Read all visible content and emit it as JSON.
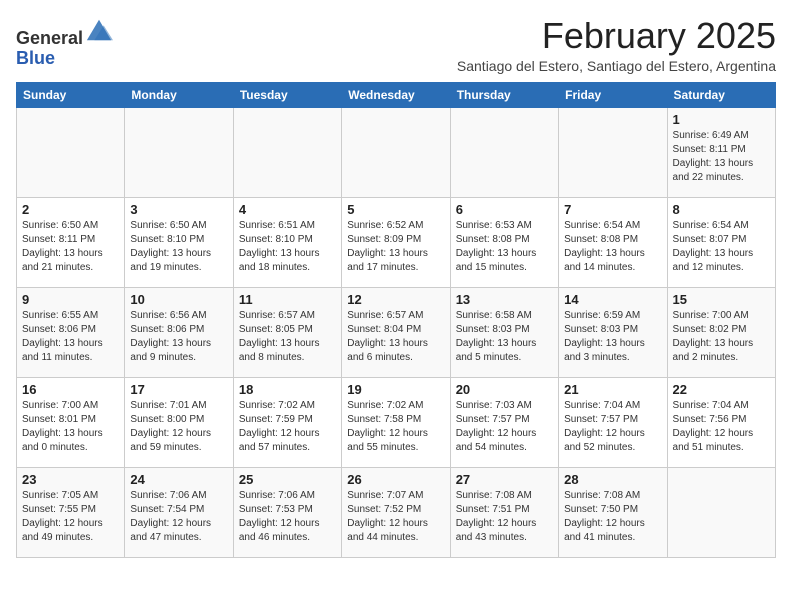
{
  "logo": {
    "general": "General",
    "blue": "Blue"
  },
  "header": {
    "month_year": "February 2025",
    "location": "Santiago del Estero, Santiago del Estero, Argentina"
  },
  "weekdays": [
    "Sunday",
    "Monday",
    "Tuesday",
    "Wednesday",
    "Thursday",
    "Friday",
    "Saturday"
  ],
  "weeks": [
    [
      {
        "day": "",
        "sunrise": "",
        "sunset": "",
        "daylight": ""
      },
      {
        "day": "",
        "sunrise": "",
        "sunset": "",
        "daylight": ""
      },
      {
        "day": "",
        "sunrise": "",
        "sunset": "",
        "daylight": ""
      },
      {
        "day": "",
        "sunrise": "",
        "sunset": "",
        "daylight": ""
      },
      {
        "day": "",
        "sunrise": "",
        "sunset": "",
        "daylight": ""
      },
      {
        "day": "",
        "sunrise": "",
        "sunset": "",
        "daylight": ""
      },
      {
        "day": "1",
        "sunrise": "Sunrise: 6:49 AM",
        "sunset": "Sunset: 8:11 PM",
        "daylight": "Daylight: 13 hours and 22 minutes."
      }
    ],
    [
      {
        "day": "2",
        "sunrise": "Sunrise: 6:50 AM",
        "sunset": "Sunset: 8:11 PM",
        "daylight": "Daylight: 13 hours and 21 minutes."
      },
      {
        "day": "3",
        "sunrise": "Sunrise: 6:50 AM",
        "sunset": "Sunset: 8:10 PM",
        "daylight": "Daylight: 13 hours and 19 minutes."
      },
      {
        "day": "4",
        "sunrise": "Sunrise: 6:51 AM",
        "sunset": "Sunset: 8:10 PM",
        "daylight": "Daylight: 13 hours and 18 minutes."
      },
      {
        "day": "5",
        "sunrise": "Sunrise: 6:52 AM",
        "sunset": "Sunset: 8:09 PM",
        "daylight": "Daylight: 13 hours and 17 minutes."
      },
      {
        "day": "6",
        "sunrise": "Sunrise: 6:53 AM",
        "sunset": "Sunset: 8:08 PM",
        "daylight": "Daylight: 13 hours and 15 minutes."
      },
      {
        "day": "7",
        "sunrise": "Sunrise: 6:54 AM",
        "sunset": "Sunset: 8:08 PM",
        "daylight": "Daylight: 13 hours and 14 minutes."
      },
      {
        "day": "8",
        "sunrise": "Sunrise: 6:54 AM",
        "sunset": "Sunset: 8:07 PM",
        "daylight": "Daylight: 13 hours and 12 minutes."
      }
    ],
    [
      {
        "day": "9",
        "sunrise": "Sunrise: 6:55 AM",
        "sunset": "Sunset: 8:06 PM",
        "daylight": "Daylight: 13 hours and 11 minutes."
      },
      {
        "day": "10",
        "sunrise": "Sunrise: 6:56 AM",
        "sunset": "Sunset: 8:06 PM",
        "daylight": "Daylight: 13 hours and 9 minutes."
      },
      {
        "day": "11",
        "sunrise": "Sunrise: 6:57 AM",
        "sunset": "Sunset: 8:05 PM",
        "daylight": "Daylight: 13 hours and 8 minutes."
      },
      {
        "day": "12",
        "sunrise": "Sunrise: 6:57 AM",
        "sunset": "Sunset: 8:04 PM",
        "daylight": "Daylight: 13 hours and 6 minutes."
      },
      {
        "day": "13",
        "sunrise": "Sunrise: 6:58 AM",
        "sunset": "Sunset: 8:03 PM",
        "daylight": "Daylight: 13 hours and 5 minutes."
      },
      {
        "day": "14",
        "sunrise": "Sunrise: 6:59 AM",
        "sunset": "Sunset: 8:03 PM",
        "daylight": "Daylight: 13 hours and 3 minutes."
      },
      {
        "day": "15",
        "sunrise": "Sunrise: 7:00 AM",
        "sunset": "Sunset: 8:02 PM",
        "daylight": "Daylight: 13 hours and 2 minutes."
      }
    ],
    [
      {
        "day": "16",
        "sunrise": "Sunrise: 7:00 AM",
        "sunset": "Sunset: 8:01 PM",
        "daylight": "Daylight: 13 hours and 0 minutes."
      },
      {
        "day": "17",
        "sunrise": "Sunrise: 7:01 AM",
        "sunset": "Sunset: 8:00 PM",
        "daylight": "Daylight: 12 hours and 59 minutes."
      },
      {
        "day": "18",
        "sunrise": "Sunrise: 7:02 AM",
        "sunset": "Sunset: 7:59 PM",
        "daylight": "Daylight: 12 hours and 57 minutes."
      },
      {
        "day": "19",
        "sunrise": "Sunrise: 7:02 AM",
        "sunset": "Sunset: 7:58 PM",
        "daylight": "Daylight: 12 hours and 55 minutes."
      },
      {
        "day": "20",
        "sunrise": "Sunrise: 7:03 AM",
        "sunset": "Sunset: 7:57 PM",
        "daylight": "Daylight: 12 hours and 54 minutes."
      },
      {
        "day": "21",
        "sunrise": "Sunrise: 7:04 AM",
        "sunset": "Sunset: 7:57 PM",
        "daylight": "Daylight: 12 hours and 52 minutes."
      },
      {
        "day": "22",
        "sunrise": "Sunrise: 7:04 AM",
        "sunset": "Sunset: 7:56 PM",
        "daylight": "Daylight: 12 hours and 51 minutes."
      }
    ],
    [
      {
        "day": "23",
        "sunrise": "Sunrise: 7:05 AM",
        "sunset": "Sunset: 7:55 PM",
        "daylight": "Daylight: 12 hours and 49 minutes."
      },
      {
        "day": "24",
        "sunrise": "Sunrise: 7:06 AM",
        "sunset": "Sunset: 7:54 PM",
        "daylight": "Daylight: 12 hours and 47 minutes."
      },
      {
        "day": "25",
        "sunrise": "Sunrise: 7:06 AM",
        "sunset": "Sunset: 7:53 PM",
        "daylight": "Daylight: 12 hours and 46 minutes."
      },
      {
        "day": "26",
        "sunrise": "Sunrise: 7:07 AM",
        "sunset": "Sunset: 7:52 PM",
        "daylight": "Daylight: 12 hours and 44 minutes."
      },
      {
        "day": "27",
        "sunrise": "Sunrise: 7:08 AM",
        "sunset": "Sunset: 7:51 PM",
        "daylight": "Daylight: 12 hours and 43 minutes."
      },
      {
        "day": "28",
        "sunrise": "Sunrise: 7:08 AM",
        "sunset": "Sunset: 7:50 PM",
        "daylight": "Daylight: 12 hours and 41 minutes."
      },
      {
        "day": "",
        "sunrise": "",
        "sunset": "",
        "daylight": ""
      }
    ]
  ]
}
